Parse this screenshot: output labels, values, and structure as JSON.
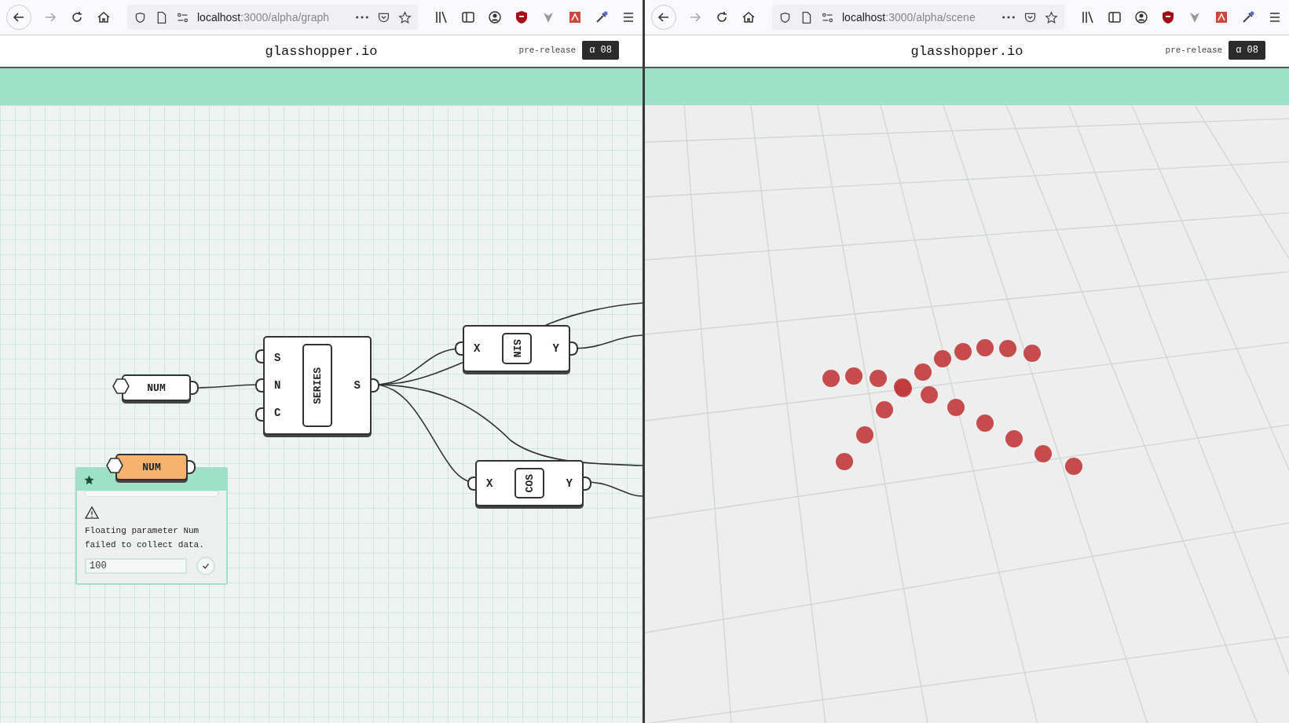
{
  "panes": [
    {
      "kind": "graph",
      "url_host": "localhost",
      "url_path": ":3000/alpha/graph",
      "title": "glasshopper.io",
      "tag": "pre-release",
      "version": "α 08",
      "nodes": [
        {
          "kind": "param",
          "label": "NUM",
          "selected": false
        },
        {
          "kind": "component",
          "label": "SERIES",
          "inputs": [
            "S",
            "N",
            "C"
          ],
          "outputs": [
            "S"
          ]
        },
        {
          "kind": "component",
          "label": "SIN",
          "inputs": [
            "X"
          ],
          "outputs": [
            "Y"
          ]
        },
        {
          "kind": "component",
          "label": "COS",
          "inputs": [
            "X"
          ],
          "outputs": [
            "Y"
          ]
        },
        {
          "kind": "param",
          "label": "NUM",
          "selected": true
        }
      ],
      "popup": {
        "message": "Floating parameter Num failed to collect data.",
        "value": "100"
      }
    },
    {
      "kind": "scene",
      "url_host": "localhost",
      "url_path": ":3000/alpha/scene",
      "title": "glasshopper.io",
      "tag": "pre-release",
      "version": "α 08"
    }
  ]
}
